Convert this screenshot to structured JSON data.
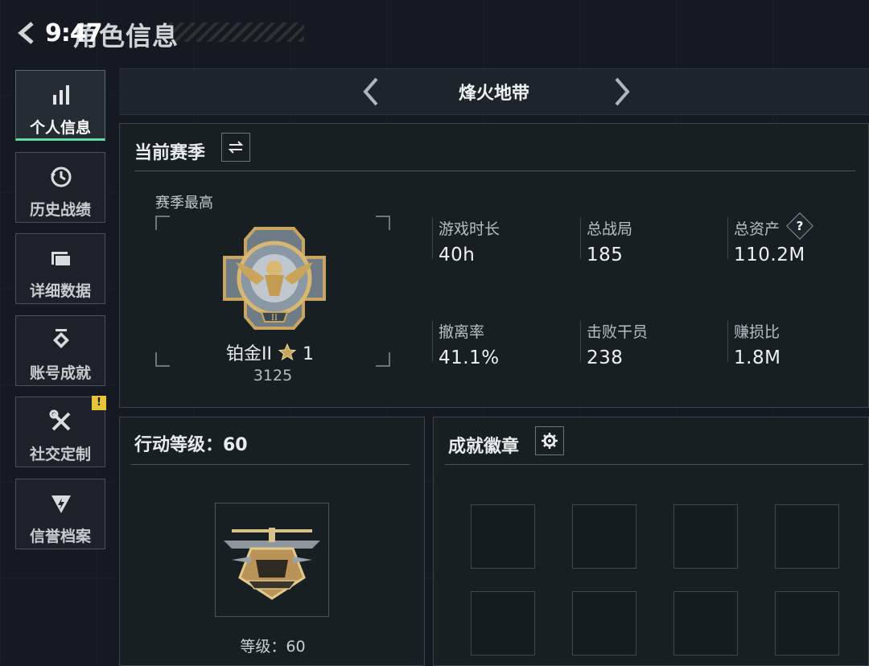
{
  "header": {
    "back_icon": "back-arrow-icon",
    "time": "9:47",
    "title": "角色信息"
  },
  "sidebar": {
    "items": [
      {
        "label": "个人信息",
        "icon": "bar-chart-icon",
        "active": true
      },
      {
        "label": "历史战绩",
        "icon": "history-clock-icon",
        "active": false
      },
      {
        "label": "详细数据",
        "icon": "folder-icon",
        "active": false
      },
      {
        "label": "账号成就",
        "icon": "achievement-icon",
        "active": false
      },
      {
        "label": "社交定制",
        "icon": "tools-icon",
        "active": false,
        "badge": "!"
      },
      {
        "label": "信誉档案",
        "icon": "credit-shield-icon",
        "active": false
      }
    ]
  },
  "mode_selector": {
    "label": "烽火地带",
    "prev_icon": "chevron-left-icon",
    "next_icon": "chevron-right-icon"
  },
  "season": {
    "title": "当前赛季",
    "switch_icon": "swap-icon",
    "rank_caption": "赛季最高",
    "rank_name": "铂金II",
    "rank_stars": "1",
    "rank_score": "3125",
    "stats": [
      {
        "label": "游戏时长",
        "value": "40h"
      },
      {
        "label": "总战局",
        "value": "185"
      },
      {
        "label": "总资产",
        "value": "110.2M",
        "help": "?"
      },
      {
        "label": "撤离率",
        "value": "41.1%"
      },
      {
        "label": "击败干员",
        "value": "238"
      },
      {
        "label": "赚损比",
        "value": "1.8M"
      }
    ]
  },
  "action_level": {
    "title": "行动等级：60",
    "level_caption": "等级：60"
  },
  "badges": {
    "title": "成就徽章",
    "settings_icon": "gear-icon",
    "slot_count": 8
  },
  "colors": {
    "accent": "#63d9a3",
    "warning": "#e9c43a",
    "background": "#141a1f",
    "gold": "#c9a560"
  }
}
